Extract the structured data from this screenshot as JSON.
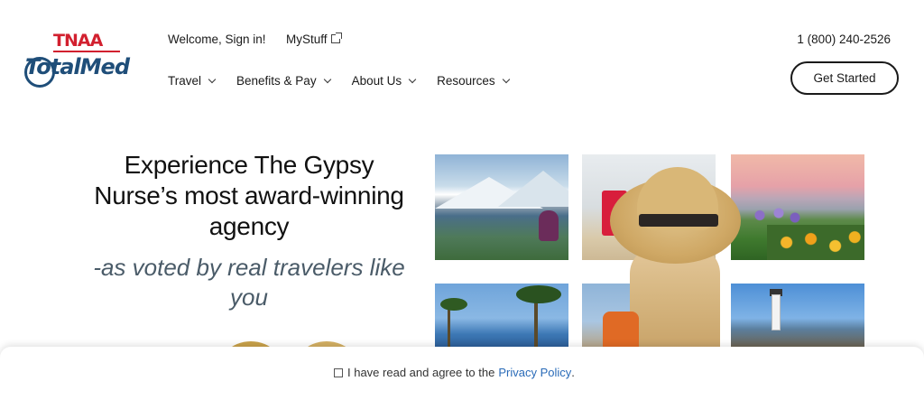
{
  "brand": {
    "top_logo": "TNAA",
    "bottom_logo": "TotalMed"
  },
  "header": {
    "sign_in": "Welcome, Sign in!",
    "mystuff": "MyStuff",
    "phone": "1 (800) 240-2526",
    "cta_label": "Get Started"
  },
  "nav": {
    "items": [
      {
        "label": "Travel"
      },
      {
        "label": "Benefits & Pay"
      },
      {
        "label": "About Us"
      },
      {
        "label": "Resources"
      }
    ]
  },
  "hero": {
    "title": "Experience The Gypsy Nurse’s most award-winning agency",
    "subtitle": "-as voted by real travelers like you"
  },
  "consent": {
    "text": "I have read and agree to the",
    "link": "Privacy Policy",
    "end": "."
  },
  "colors": {
    "tnaa_red": "#d2202f",
    "totalmed_blue": "#1f4e79",
    "link_blue": "#2a6bb8"
  }
}
